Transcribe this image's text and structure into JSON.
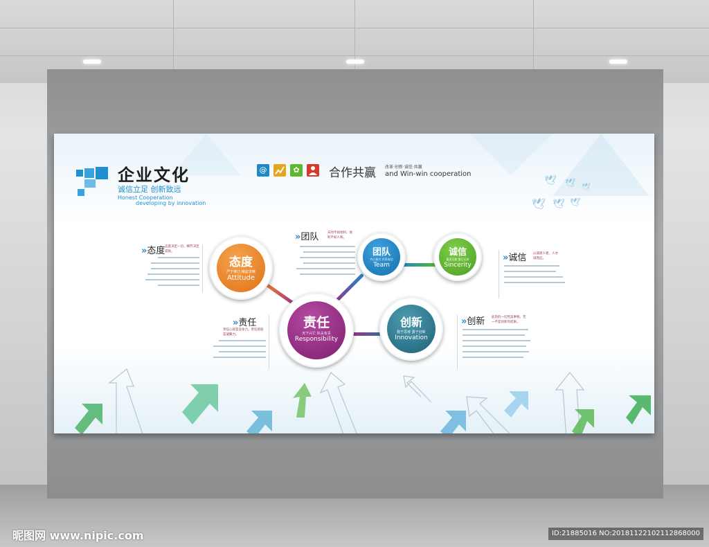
{
  "heading": {
    "title_cn": "企业文化",
    "subtitle_cn": "诚信立足  创新致远",
    "subtitle_en_1": "Honest Cooperation",
    "subtitle_en_2": "developing by innovation"
  },
  "cooperation": {
    "title_cn": "合作共赢",
    "small_text": "改革·创新·诚信·共赢",
    "title_en": "and Win-win  cooperation",
    "icons": [
      "at-icon",
      "chart-icon",
      "flower-icon",
      "person-icon"
    ]
  },
  "circles": {
    "attitude": {
      "cn": "态度",
      "sub": "严于律己  精益求精",
      "en": "Attitude",
      "color": "#e8822a"
    },
    "team": {
      "cn": "团队",
      "sub": "齐心协力  共享成功",
      "en": "Team",
      "color": "#1f88c7"
    },
    "sincerity": {
      "cn": "诚信",
      "sub": "童叟无欺  重石无弃",
      "en": "Sincerity",
      "color": "#5cb82e"
    },
    "responsibility": {
      "cn": "责任",
      "sub": "天下兴亡  匹夫有责",
      "en": "Responsibility",
      "color": "#9a2f86"
    },
    "innovation": {
      "cn": "创新",
      "sub": "勤于思考  勇于创新",
      "en": "Innovation",
      "color": "#2c7d95"
    }
  },
  "sections": {
    "attitude": {
      "heading": "态度",
      "desc": "态度决定一切，细节决定成败。"
    },
    "team": {
      "heading": "团队",
      "desc": "天时不如地利，地利不如人和。"
    },
    "sincerity": {
      "heading": "诚信",
      "desc": "以诚感人者，人亦诚而应。"
    },
    "responsibility": {
      "heading": "责任",
      "desc": "责任心就是竞争力，责任感就是凝聚力。"
    },
    "innovation": {
      "heading": "创新",
      "desc": "此刻的一切完美事物，无一不是创新的结果。"
    }
  },
  "watermark": {
    "left": "昵图网 www.nipic.com",
    "right": "ID:21885016 NO:20181122102112868000"
  }
}
